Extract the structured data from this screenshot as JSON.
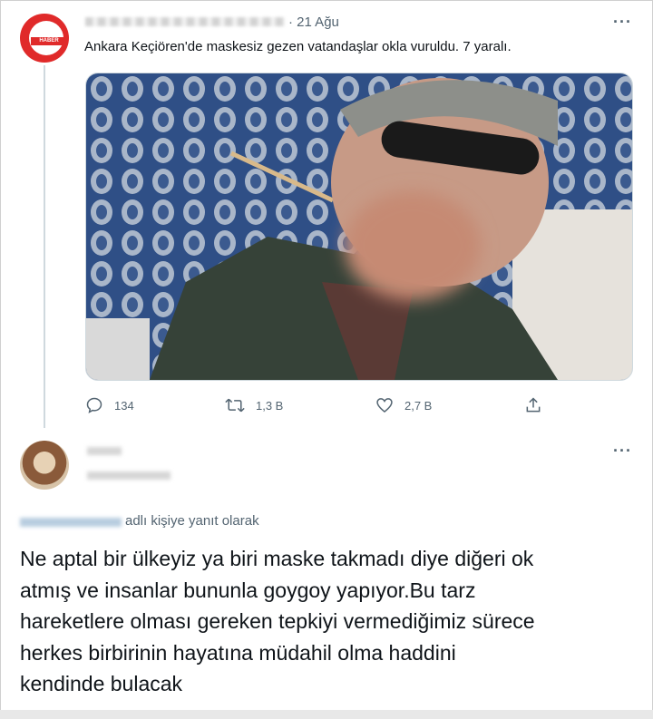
{
  "tweet1": {
    "avatar_badge": "HABER",
    "date": "· 21 Ağu",
    "more": "···",
    "text": "Ankara Keçiören'de maskesiz gezen vatandaşlar okla vuruldu. 7 yaralı.",
    "actions": {
      "reply_count": "134",
      "retweet_count": "1,3 B",
      "like_count": "2,7 B"
    }
  },
  "tweet2": {
    "more": "···",
    "reply_context": "adlı kişiye yanıt olarak",
    "lines": [
      "Ne aptal bir ülkeyiz ya biri maske takmadı diye diğeri ok",
      "atmış ve insanlar bununla goygoy yapıyor.Bu tarz",
      "hareketlere olması gereken tepkiyi vermediğimiz sürece",
      "herkes birbirinin hayatına müdahil olma haddini",
      "kendinde bulacak"
    ]
  },
  "colors": {
    "secondary_text": "#536471",
    "avatar_red": "#e02a2a",
    "thread_line": "#cfd9de"
  },
  "icons": [
    "more-icon",
    "reply-icon",
    "retweet-icon",
    "like-icon",
    "share-icon"
  ]
}
